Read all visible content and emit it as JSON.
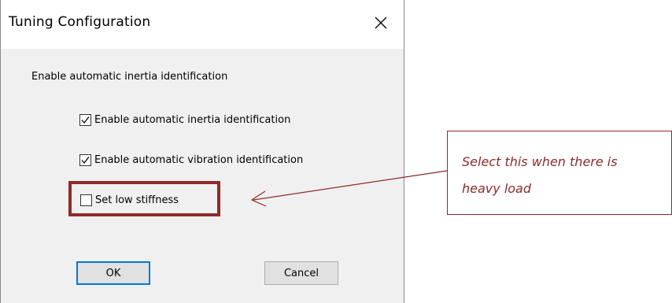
{
  "dialog": {
    "title": "Tuning Configuration",
    "close_icon": "close-icon",
    "header_label": "Enable automatic inertia identification",
    "options": [
      {
        "label": "Enable automatic inertia identification",
        "checked": true
      },
      {
        "label": "Enable automatic vibration identification",
        "checked": true
      },
      {
        "label": "Set low stiffness",
        "checked": false
      }
    ],
    "buttons": {
      "ok_label": "OK",
      "cancel_label": "Cancel"
    }
  },
  "annotation": {
    "callout_text": "Select this when there is heavy load",
    "color": "#8e2a2a"
  },
  "colors": {
    "dialog_background": "#f0f0f0",
    "title_background": "#ffffff",
    "default_button_border": "#0078d7"
  }
}
